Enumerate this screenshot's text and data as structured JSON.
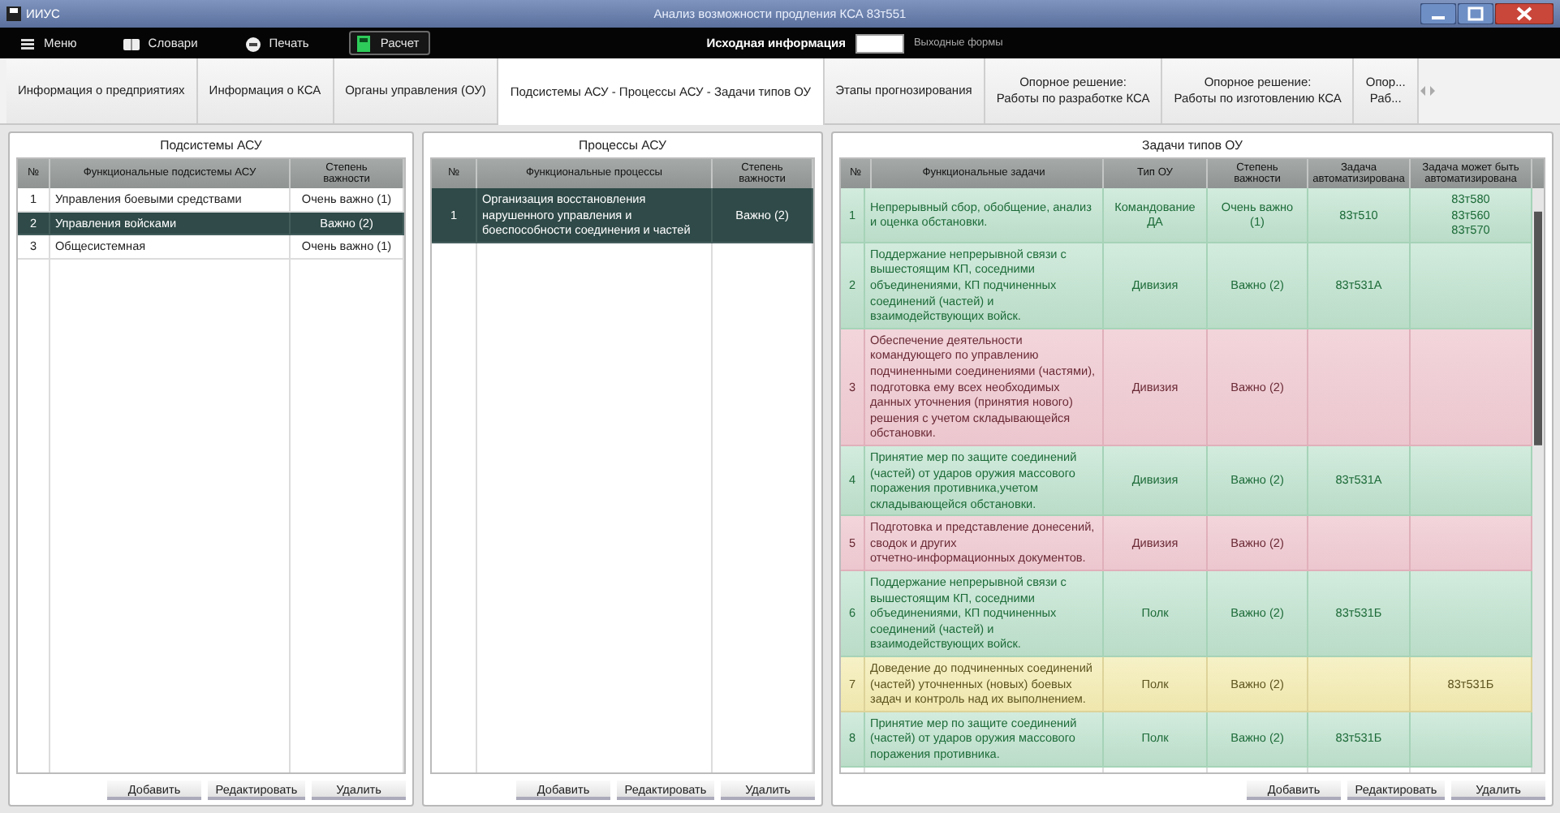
{
  "window": {
    "app": "ИИУС",
    "title": "Анализ возможности продления КСА 83т551"
  },
  "toolbar": {
    "items": [
      {
        "label": "Меню",
        "selected": false
      },
      {
        "label": "Словари",
        "selected": false
      },
      {
        "label": "Печать",
        "selected": false
      },
      {
        "label": "Расчет",
        "selected": true
      }
    ],
    "mode_left": "Исходная информация",
    "mode_right": "Выходные формы",
    "mode_output": false
  },
  "tabs": [
    {
      "label": "Информация о предприятиях",
      "selected": false
    },
    {
      "label": "Информация о КСА",
      "selected": false
    },
    {
      "label": "Органы управления (ОУ)",
      "selected": false
    },
    {
      "label": "Подсистемы АСУ - Процессы АСУ - Задачи типов ОУ",
      "selected": true
    },
    {
      "label": "Этапы прогнозирования",
      "selected": false
    },
    {
      "label": "Опорное решение:\nРаботы по разработке КСА",
      "selected": false
    },
    {
      "label": "Опорное решение:\nРаботы по изготовлению КСА",
      "selected": false
    },
    {
      "label": "Опор...\nРаб...",
      "selected": false
    }
  ],
  "panels": [
    {
      "kind": "subsystems",
      "title": "Подсистемы АСУ",
      "columns": [
        "№",
        "Функциональные подсистемы АСУ",
        "Степень важности"
      ],
      "rows": [
        {
          "cells": [
            "1",
            "Управления боевыми средствами",
            "Очень важно (1)"
          ],
          "selected": false
        },
        {
          "cells": [
            "2",
            "Управления войсками",
            "Важно (2)"
          ],
          "selected": true
        },
        {
          "cells": [
            "3",
            "Общесистемная",
            "Очень важно (1)"
          ],
          "selected": false
        }
      ],
      "buttons": [
        "Добавить",
        "Редактировать",
        "Удалить"
      ]
    },
    {
      "kind": "processes",
      "title": "Процессы АСУ",
      "columns": [
        "№",
        "Функциональные процессы",
        "Степень важности"
      ],
      "rows": [
        {
          "cells": [
            "1",
            "Организация восстановления нарушенного управления и боеспособности соединения и частей",
            "Важно (2)"
          ],
          "selected": true
        }
      ],
      "buttons": [
        "Добавить",
        "Редактировать",
        "Удалить"
      ]
    },
    {
      "kind": "tasks",
      "title": "Задачи типов ОУ",
      "columns": [
        "№",
        "Функциональные задачи",
        "Тип ОУ",
        "Степень важности",
        "Задача автоматизирована",
        "Задача может быть автоматизирована"
      ],
      "rows": [
        {
          "kind": "automated",
          "cells": [
            "1",
            "Непрерывный сбор, обобщение, анализ и оценка обстановки.",
            "Командование ДА",
            "Очень важно (1)",
            "83т510",
            "83т580\n83т560\n83т570"
          ]
        },
        {
          "kind": "automated",
          "cells": [
            "2",
            "Поддержание непрерывной связи с вышестоящим КП, соседними объединениями, КП подчиненных соединений (частей) и взаимодействующих войск.",
            "Дивизия",
            "Важно (2)",
            "83т531А"
          ]
        },
        {
          "kind": "missing",
          "cells": [
            "3",
            "Обеспечение деятельности командующего по управлению подчиненными соединениями (частями), подготовка ему всех необходимых данных уточнения (принятия нового) решения с учетом складывающейся обстановки.",
            "Дивизия",
            "Важно (2)"
          ]
        },
        {
          "kind": "automated",
          "cells": [
            "4",
            "Принятие мер по защите соединений (частей) от ударов оружия массового поражения противника,учетом складывающейся обстановки.",
            "Дивизия",
            "Важно (2)",
            "83т531А"
          ]
        },
        {
          "kind": "missing",
          "cells": [
            "5",
            "Подготовка и представление донесений, сводок и других\nотчетно-информационных документов.",
            "Дивизия",
            "Важно (2)"
          ]
        },
        {
          "kind": "automated",
          "cells": [
            "6",
            "Поддержание непрерывной связи с вышестоящим КП, соседними объединениями, КП подчиненных соединений (частей) и взаимодействующих войск.",
            "Полк",
            "Важно (2)",
            "83т531Б"
          ]
        },
        {
          "kind": "possible",
          "cells": [
            "7",
            "Доведение до подчиненных соединений (частей) уточненных (новых) боевых задач и контроль над их выполнением.",
            "Полк",
            "Важно (2)",
            "",
            "83т531Б"
          ]
        },
        {
          "kind": "automated",
          "cells": [
            "8",
            "Принятие мер по защите соединений (частей) от ударов оружия массового поражения противника.",
            "Полк",
            "Важно (2)",
            "83т531Б"
          ]
        }
      ],
      "buttons": [
        "Добавить",
        "Редактировать",
        "Удалить"
      ]
    }
  ]
}
